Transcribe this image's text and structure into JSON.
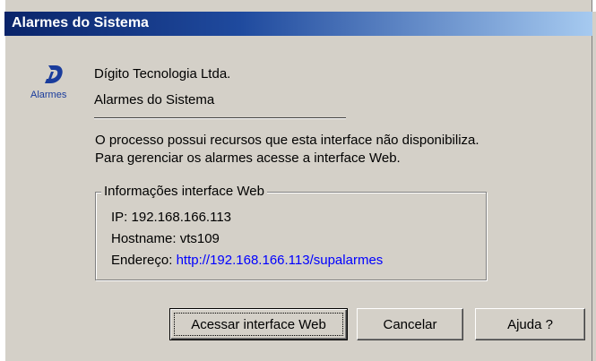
{
  "window": {
    "title": "Alarmes do Sistema"
  },
  "header": {
    "logo_label": "Alarmes",
    "company": "Dígito Tecnologia Ltda.",
    "product": "Alarmes do Sistema"
  },
  "message": {
    "line1": "O processo possui recursos que esta interface não disponibiliza.",
    "line2": "Para gerenciar os alarmes acesse a interface Web."
  },
  "info": {
    "legend": "Informações interface Web",
    "ip": "IP: 192.168.166.113",
    "hostname": "Hostname: vts109",
    "address_label": "Endereço:",
    "address_url": "http://192.168.166.113/supalarmes"
  },
  "buttons": {
    "access": "Acessar interface Web",
    "cancel": "Cancelar",
    "help": "Ajuda ?"
  },
  "colors": {
    "titlebar": "#0a246a",
    "dialog_bg": "#d4d0c8",
    "link": "#0000ff",
    "logo": "#1a3c9c"
  }
}
